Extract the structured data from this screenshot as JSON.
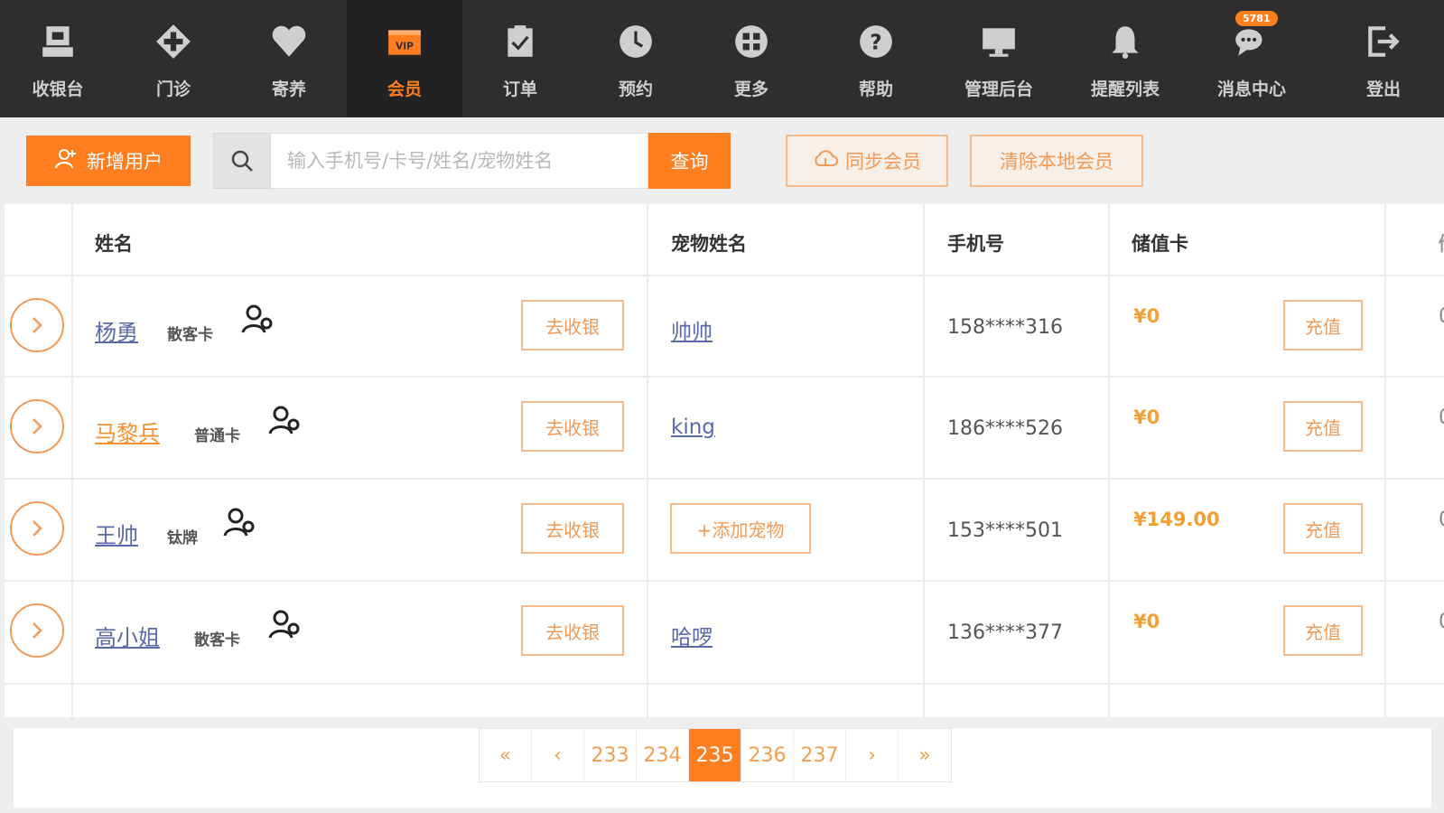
{
  "nav": {
    "items": [
      {
        "label": "收银台",
        "icon": "cashier-icon"
      },
      {
        "label": "门诊",
        "icon": "clinic-cross-icon"
      },
      {
        "label": "寄养",
        "icon": "heart-icon"
      },
      {
        "label": "会员",
        "icon": "vip-card-icon"
      },
      {
        "label": "订单",
        "icon": "clipboard-icon"
      },
      {
        "label": "预约",
        "icon": "clock-icon"
      },
      {
        "label": "更多",
        "icon": "more-grid-icon"
      },
      {
        "label": "帮助",
        "icon": "help-icon"
      },
      {
        "label": "管理后台",
        "icon": "monitor-icon"
      },
      {
        "label": "提醒列表",
        "icon": "bell-icon"
      },
      {
        "label": "消息中心",
        "icon": "chat-icon"
      },
      {
        "label": "登出",
        "icon": "logout-icon"
      }
    ],
    "active": "会员",
    "message_badge": "5781"
  },
  "toolbar": {
    "new_user_label": "新增用户",
    "search_placeholder": "输入手机号/卡号/姓名/宠物姓名",
    "search_value": "",
    "query_label": "查询",
    "sync_label": "同步会员",
    "clear_label": "清除本地会员"
  },
  "table": {
    "headers": [
      "姓名",
      "宠物姓名",
      "手机号",
      "储值卡"
    ],
    "rows": [
      {
        "name": "杨勇",
        "name_color": "blue",
        "card": "散客卡",
        "cashier": "去收银",
        "pet": "帅帅",
        "phone": "158****316",
        "balance": "¥0",
        "recharge": "充值",
        "next_col": "0"
      },
      {
        "name": "马黎兵",
        "name_color": "orange",
        "card": "普通卡",
        "cashier": "去收银",
        "pet": "king",
        "phone": "186****526",
        "balance": "¥0",
        "recharge": "充值",
        "next_col": "0"
      },
      {
        "name": "王帅",
        "name_color": "blue",
        "card": "钛牌",
        "cashier": "去收银",
        "pet": "+添加宠物",
        "phone": "153****501",
        "balance": "¥149.00",
        "recharge": "充值",
        "next_col": "0"
      },
      {
        "name": "高小姐",
        "name_color": "blue",
        "card": "散客卡",
        "cashier": "去收银",
        "pet": "哈啰",
        "phone": "136****377",
        "balance": "¥0",
        "recharge": "充值",
        "next_col": "0"
      }
    ]
  },
  "pagination": {
    "first": "«",
    "prev": "‹",
    "pages": [
      "233",
      "234",
      "235",
      "236",
      "237"
    ],
    "current": "235",
    "next": "›",
    "last": "»"
  },
  "colors": {
    "accent": "#ff7e1f",
    "nav_bg": "#2e2e2e",
    "link_blue": "#5a6aa8"
  }
}
